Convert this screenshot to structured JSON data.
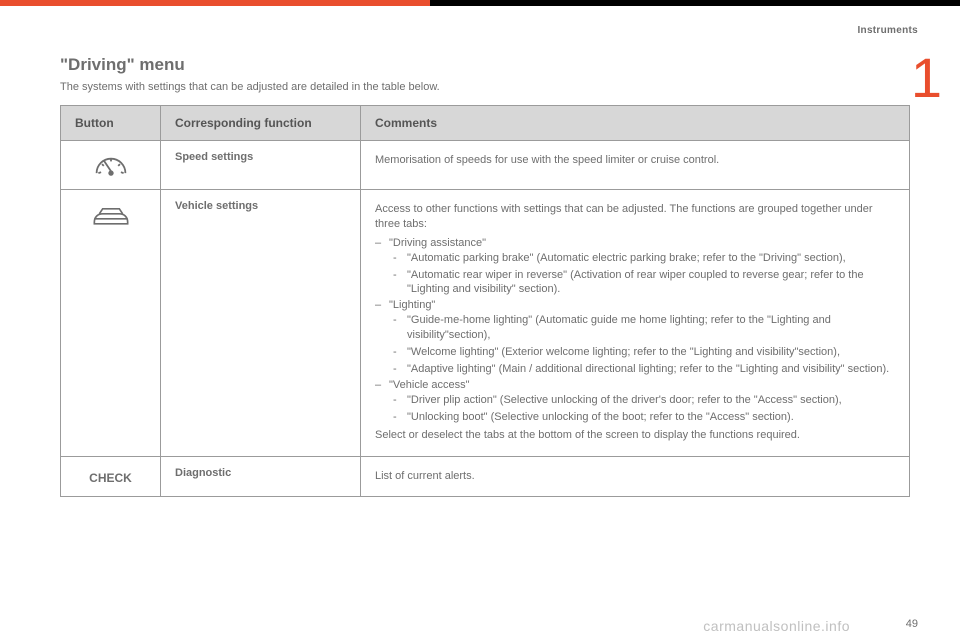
{
  "header": {
    "section": "Instruments",
    "tab_number": "1"
  },
  "page": {
    "title": "\"Driving\" menu",
    "intro": "The systems with settings that can be adjusted are detailed in the table below."
  },
  "table": {
    "headers": {
      "button": "Button",
      "function": "Corresponding function",
      "comments": "Comments"
    },
    "rows": [
      {
        "icon": "gauge",
        "function": "Speed settings",
        "comments_plain": "Memorisation of speeds for use with the speed limiter or cruise control."
      },
      {
        "icon": "car",
        "function": "Vehicle settings",
        "comments_intro": "Access to other functions with settings that can be adjusted. The functions are grouped together under three tabs:",
        "tabs": [
          {
            "label": "\"Driving assistance\"",
            "items": [
              "\"Automatic parking brake\" (Automatic electric parking brake; refer to the \"Driving\" section),",
              "\"Automatic rear wiper in reverse\" (Activation of rear wiper coupled to reverse gear; refer to the \"Lighting and visibility\" section)."
            ]
          },
          {
            "label": "\"Lighting\"",
            "items": [
              "\"Guide-me-home lighting\" (Automatic guide me home lighting; refer to the \"Lighting and visibility\"section),",
              "\"Welcome lighting\" (Exterior welcome lighting; refer to the \"Lighting and visibility\"section),",
              "\"Adaptive lighting\" (Main / additional directional lighting; refer to the \"Lighting and visibility\" section)."
            ]
          },
          {
            "label": "\"Vehicle access\"",
            "items": [
              "\"Driver plip action\" (Selective unlocking of the driver's door; refer to the \"Access\" section),",
              "\"Unlocking boot\" (Selective unlocking of the boot; refer to the \"Access\" section)."
            ]
          }
        ],
        "comments_outro": "Select or deselect the tabs at the bottom of the screen to display the functions required."
      },
      {
        "icon": "check",
        "icon_label": "CHECK",
        "function": "Diagnostic",
        "comments_plain": "List of current alerts."
      }
    ]
  },
  "footer": {
    "url": "carmanualsonline.info",
    "page_number": "49"
  }
}
